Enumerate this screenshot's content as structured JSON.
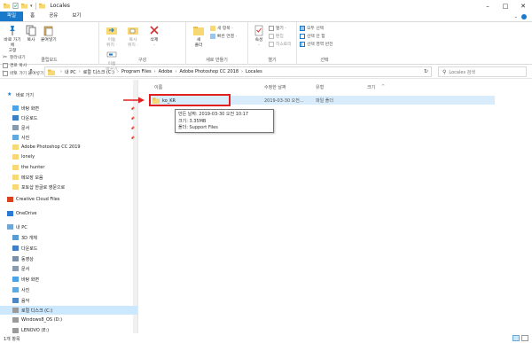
{
  "window": {
    "title": "Locales"
  },
  "window_controls": {
    "minimize": "–",
    "maximize": "□",
    "close": "✕"
  },
  "ribbon_tabs": [
    "파일",
    "홈",
    "공유",
    "보기"
  ],
  "ribbon": {
    "clipboard": {
      "pin_label": "바로 가기에\n고정",
      "copy_label": "복사",
      "paste_label": "붙여넣기",
      "cut": "잘라내기",
      "copy_path": "경로 복사",
      "paste_shortcut": "바로 가기 붙여넣기",
      "group_label": "클립보드"
    },
    "organize": {
      "move_label": "이동\n위치 ·",
      "copy_label": "복사\n위치 ·",
      "delete_label": "삭제\n·",
      "rename_label": "이름\n바꾸기",
      "group_label": "구성"
    },
    "new": {
      "new_folder_label": "새\n폴더",
      "new_item": "새 항목 ·",
      "easy_access": "빠른 연결 ·",
      "group_label": "새로 만들기"
    },
    "open": {
      "properties_label": "속성\n·",
      "open": "열기 ·",
      "edit": "편집",
      "history": "히스토리",
      "group_label": "열기"
    },
    "select": {
      "select_all": "모두 선택",
      "select_none": "선택 안 함",
      "invert_selection": "선택 영역 반전",
      "group_label": "선택"
    }
  },
  "address": {
    "crumbs": [
      "내 PC",
      "로컬 디스크 (C:)",
      "Program Files",
      "Adobe",
      "Adobe Photoshop CC 2018",
      "Locales"
    ],
    "search_placeholder": "Locales 검색"
  },
  "navpane": {
    "items": [
      {
        "label": "바로 가기",
        "icon": "star-icon",
        "pinned": false
      },
      {
        "label": "바탕 화면",
        "icon": "desktop-icon",
        "pinned": true
      },
      {
        "label": "다운로드",
        "icon": "download-icon",
        "pinned": true
      },
      {
        "label": "문서",
        "icon": "document-icon",
        "pinned": true
      },
      {
        "label": "사진",
        "icon": "pictures-icon",
        "pinned": true
      },
      {
        "label": "Adobe Photoshop CC 2019",
        "icon": "folder-icon",
        "pinned": false
      },
      {
        "label": "lonely",
        "icon": "folder-icon",
        "pinned": false
      },
      {
        "label": "the hunter",
        "icon": "folder-icon",
        "pinned": false
      },
      {
        "label": "메모장 모음",
        "icon": "folder-icon",
        "pinned": false
      },
      {
        "label": "포토샵 한글로 영문으로",
        "icon": "folder-icon",
        "pinned": false
      },
      {
        "label": "Creative Cloud Files",
        "icon": "creative-cloud-icon",
        "pinned": false
      },
      {
        "label": "OneDrive",
        "icon": "onedrive-icon",
        "pinned": false
      },
      {
        "label": "내 PC",
        "icon": "pc-icon",
        "pinned": false
      },
      {
        "label": "3D 개체",
        "icon": "3d-objects-icon",
        "pinned": false
      },
      {
        "label": "다운로드",
        "icon": "download-icon",
        "pinned": false
      },
      {
        "label": "동영상",
        "icon": "video-icon",
        "pinned": false
      },
      {
        "label": "문서",
        "icon": "document-icon",
        "pinned": false
      },
      {
        "label": "바탕 화면",
        "icon": "desktop-icon",
        "pinned": false
      },
      {
        "label": "사진",
        "icon": "pictures-icon",
        "pinned": false
      },
      {
        "label": "음악",
        "icon": "music-icon",
        "pinned": false
      },
      {
        "label": "로컬 디스크 (C:)",
        "icon": "drive-icon",
        "pinned": false,
        "selected": true
      },
      {
        "label": "Windows8_OS (D:)",
        "icon": "drive-icon",
        "pinned": false
      },
      {
        "label": "LENOVO (E:)",
        "icon": "drive-icon",
        "pinned": false
      }
    ]
  },
  "columns": {
    "name": "이름",
    "date": "수정한 날짜",
    "type": "유형",
    "size": "크기"
  },
  "files": [
    {
      "name": "ko_KR",
      "date": "2019-03-30 오전...",
      "type": "파일 폴더",
      "size": ""
    }
  ],
  "tooltip": {
    "created": "만든 날짜: 2019-03-30 오전 10:17",
    "size": "크기: 3.35MB",
    "folders": "폴더: Support Files"
  },
  "status": {
    "count": "1개 항목"
  },
  "colors": {
    "accent": "#1979ca",
    "selection": "#cce8ff",
    "highlight_box": "#e31e1e",
    "folder": "#f8d775"
  }
}
